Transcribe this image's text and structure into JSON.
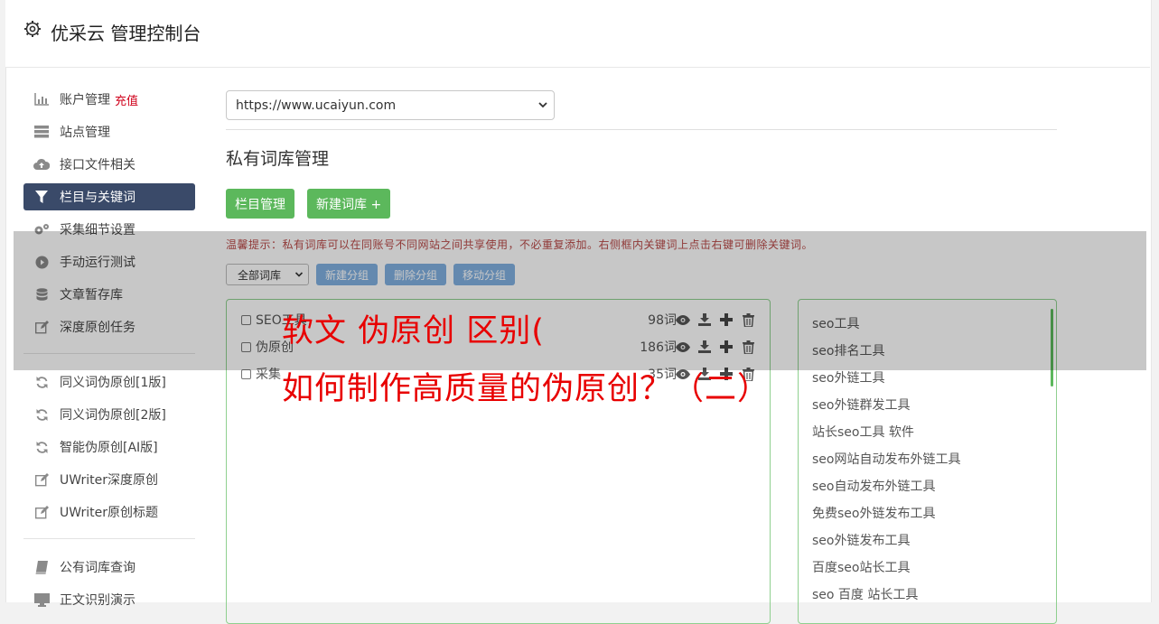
{
  "header": {
    "title": "优采云 管理控制台"
  },
  "sidebar": {
    "items": [
      {
        "label": "账户管理",
        "extra": "充值",
        "icon": "bar-chart-icon"
      },
      {
        "label": "站点管理",
        "icon": "server-icon"
      },
      {
        "label": "接口文件相关",
        "icon": "cloud-upload-icon"
      },
      {
        "label": "栏目与关键词",
        "icon": "filter-icon",
        "active": true
      },
      {
        "label": "采集细节设置",
        "icon": "gears-icon"
      },
      {
        "label": "手动运行测试",
        "icon": "play-circle-icon"
      },
      {
        "label": "文章暂存库",
        "icon": "database-icon"
      },
      {
        "label": "深度原创任务",
        "icon": "edit-icon"
      },
      {
        "label": "同义词伪原创[1版]",
        "icon": "refresh-icon"
      },
      {
        "label": "同义词伪原创[2版]",
        "icon": "refresh-icon"
      },
      {
        "label": "智能伪原创[AI版]",
        "icon": "refresh-icon"
      },
      {
        "label": "UWriter深度原创",
        "icon": "edit-icon"
      },
      {
        "label": "UWriter原创标题",
        "icon": "edit-icon"
      },
      {
        "label": "公有词库查询",
        "icon": "book-icon"
      },
      {
        "label": "正文识别演示",
        "icon": "monitor-icon"
      }
    ]
  },
  "main": {
    "site_select": "https://www.ucaiyun.com",
    "section_title": "私有词库管理",
    "btn_columns": "栏目管理",
    "btn_new_lib": "新建词库 +",
    "tip": "温馨提示：私有词库可以在同账号不同网站之间共享使用，不必重复添加。右侧框内关键词上点击右键可删除关键词。",
    "filter_select": "全部词库",
    "btn_new_group": "新建分组",
    "btn_delete_group": "删除分组",
    "btn_move_group": "移动分组",
    "libraries": [
      {
        "name": "SEO工具",
        "count": "98词"
      },
      {
        "name": "伪原创",
        "count": "186词"
      },
      {
        "name": "采集",
        "count": "35词"
      }
    ],
    "keywords": [
      "seo工具",
      "seo排名工具",
      "seo外链工具",
      "seo外链群发工具",
      "站长seo工具 软件",
      "seo网站自动发布外链工具",
      "seo自动发布外链工具",
      "免费seo外链发布工具",
      "seo外链发布工具",
      "百度seo站长工具",
      "seo 百度 站长工具"
    ]
  },
  "overlay": {
    "line1": "软文 伪原创 区别(",
    "line2": "如何制作高质量的伪原创？（二）"
  },
  "colors": {
    "accent_nav": "#3a4a69",
    "green": "#5cb85c",
    "blue_btn": "#80b0e0",
    "overlay_text": "#e80000"
  }
}
